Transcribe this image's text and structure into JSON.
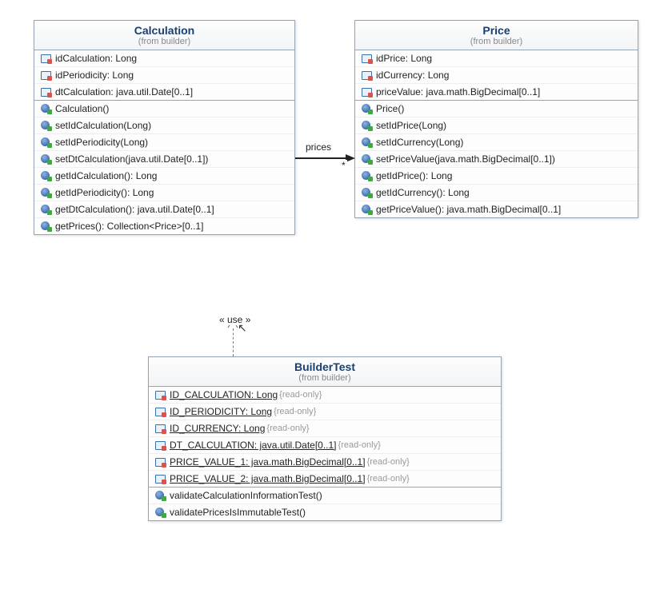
{
  "classes": {
    "calculation": {
      "name": "Calculation",
      "package": "(from builder)",
      "attributes": [
        "idCalculation: Long",
        "idPeriodicity: Long",
        "dtCalculation: java.util.Date[0..1]"
      ],
      "methods": [
        "Calculation()",
        "setIdCalculation(Long)",
        "setIdPeriodicity(Long)",
        "setDtCalculation(java.util.Date[0..1])",
        "getIdCalculation(): Long",
        "getIdPeriodicity(): Long",
        "getDtCalculation(): java.util.Date[0..1]",
        "getPrices(): Collection<Price>[0..1]"
      ]
    },
    "price": {
      "name": "Price",
      "package": "(from builder)",
      "attributes": [
        "idPrice: Long",
        "idCurrency: Long",
        "priceValue: java.math.BigDecimal[0..1]"
      ],
      "methods": [
        "Price()",
        "setIdPrice(Long)",
        "setIdCurrency(Long)",
        "setPriceValue(java.math.BigDecimal[0..1])",
        "getIdPrice(): Long",
        "getIdCurrency(): Long",
        "getPriceValue(): java.math.BigDecimal[0..1]"
      ]
    },
    "builderTest": {
      "name": "BuilderTest",
      "package": "(from builder)",
      "attributes": [
        {
          "text": "ID_CALCULATION: Long",
          "readonly": "{read-only}"
        },
        {
          "text": "ID_PERIODICITY: Long",
          "readonly": "{read-only}"
        },
        {
          "text": "ID_CURRENCY: Long",
          "readonly": "{read-only}"
        },
        {
          "text": "DT_CALCULATION: java.util.Date[0..1]",
          "readonly": "{read-only}"
        },
        {
          "text": "PRICE_VALUE_1: java.math.BigDecimal[0..1]",
          "readonly": "{read-only}"
        },
        {
          "text": "PRICE_VALUE_2: java.math.BigDecimal[0..1]",
          "readonly": "{read-only}"
        }
      ],
      "methods": [
        "validateCalculationInformationTest()",
        "validatePricesIsImmutableTest()"
      ]
    }
  },
  "association": {
    "label": "prices",
    "multiplicity": "*"
  },
  "dependency": {
    "label": "« use »"
  },
  "chart_data": {
    "type": "uml-class-diagram",
    "classes": [
      {
        "name": "Calculation",
        "package": "builder",
        "attributes": [
          {
            "name": "idCalculation",
            "type": "Long",
            "visibility": "private"
          },
          {
            "name": "idPeriodicity",
            "type": "Long",
            "visibility": "private"
          },
          {
            "name": "dtCalculation",
            "type": "java.util.Date",
            "multiplicity": "0..1",
            "visibility": "private"
          }
        ],
        "operations": [
          {
            "name": "Calculation",
            "kind": "constructor"
          },
          {
            "name": "setIdCalculation",
            "params": [
              "Long"
            ]
          },
          {
            "name": "setIdPeriodicity",
            "params": [
              "Long"
            ]
          },
          {
            "name": "setDtCalculation",
            "params": [
              "java.util.Date[0..1]"
            ]
          },
          {
            "name": "getIdCalculation",
            "return": "Long"
          },
          {
            "name": "getIdPeriodicity",
            "return": "Long"
          },
          {
            "name": "getDtCalculation",
            "return": "java.util.Date[0..1]"
          },
          {
            "name": "getPrices",
            "return": "Collection<Price>[0..1]"
          }
        ]
      },
      {
        "name": "Price",
        "package": "builder",
        "attributes": [
          {
            "name": "idPrice",
            "type": "Long",
            "visibility": "private"
          },
          {
            "name": "idCurrency",
            "type": "Long",
            "visibility": "private"
          },
          {
            "name": "priceValue",
            "type": "java.math.BigDecimal",
            "multiplicity": "0..1",
            "visibility": "private"
          }
        ],
        "operations": [
          {
            "name": "Price",
            "kind": "constructor"
          },
          {
            "name": "setIdPrice",
            "params": [
              "Long"
            ]
          },
          {
            "name": "setIdCurrency",
            "params": [
              "Long"
            ]
          },
          {
            "name": "setPriceValue",
            "params": [
              "java.math.BigDecimal[0..1]"
            ]
          },
          {
            "name": "getIdPrice",
            "return": "Long"
          },
          {
            "name": "getIdCurrency",
            "return": "Long"
          },
          {
            "name": "getPriceValue",
            "return": "java.math.BigDecimal[0..1]"
          }
        ]
      },
      {
        "name": "BuilderTest",
        "package": "builder",
        "attributes": [
          {
            "name": "ID_CALCULATION",
            "type": "Long",
            "static": true,
            "readOnly": true
          },
          {
            "name": "ID_PERIODICITY",
            "type": "Long",
            "static": true,
            "readOnly": true
          },
          {
            "name": "ID_CURRENCY",
            "type": "Long",
            "static": true,
            "readOnly": true
          },
          {
            "name": "DT_CALCULATION",
            "type": "java.util.Date",
            "multiplicity": "0..1",
            "static": true,
            "readOnly": true
          },
          {
            "name": "PRICE_VALUE_1",
            "type": "java.math.BigDecimal",
            "multiplicity": "0..1",
            "static": true,
            "readOnly": true
          },
          {
            "name": "PRICE_VALUE_2",
            "type": "java.math.BigDecimal",
            "multiplicity": "0..1",
            "static": true,
            "readOnly": true
          }
        ],
        "operations": [
          {
            "name": "validateCalculationInformationTest"
          },
          {
            "name": "validatePricesIsImmutableTest"
          }
        ]
      }
    ],
    "relationships": [
      {
        "type": "association",
        "from": "Calculation",
        "to": "Price",
        "role": "prices",
        "multiplicity": "*",
        "navigable": true
      },
      {
        "type": "dependency",
        "from": "BuilderTest",
        "to": "Calculation",
        "stereotype": "use"
      }
    ]
  }
}
